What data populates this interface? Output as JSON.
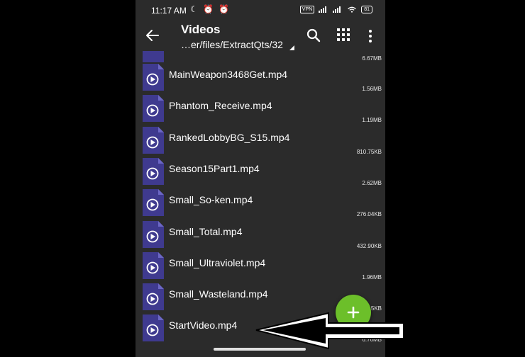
{
  "status_bar": {
    "time": "11:17 AM",
    "glyphs": "☾ ⏰ ⏰",
    "vpn": "VPN",
    "battery": "81"
  },
  "app_bar": {
    "title": "Videos",
    "path": "…er/files/ExtractQts/32"
  },
  "icons": {
    "back": "arrow-left-icon",
    "search": "search-icon",
    "grid": "grid-view-icon",
    "more": "more-vertical-icon",
    "file": "video-file-icon",
    "add": "plus-icon"
  },
  "colors": {
    "background": "#2b2b2b",
    "file_icon": "#3f3a8f",
    "fab": "#6cbf2a"
  },
  "files": {
    "partial_top_size": "6.67MB",
    "items": [
      {
        "name": "MainWeapon3468Get.mp4",
        "size": "1.56MB"
      },
      {
        "name": "Phantom_Receive.mp4",
        "size": "1.19MB"
      },
      {
        "name": "RankedLobbyBG_S15.mp4",
        "size": "810.75KB"
      },
      {
        "name": "Season15Part1.mp4",
        "size": "2.62MB"
      },
      {
        "name": "Small_So-ken.mp4",
        "size": "276.04KB"
      },
      {
        "name": "Small_Total.mp4",
        "size": "432.90KB"
      },
      {
        "name": "Small_Ultraviolet.mp4",
        "size": "1.96MB"
      },
      {
        "name": "Small_Wasteland.mp4",
        "size": "5KB"
      },
      {
        "name": "StartVideo.mp4",
        "size": "6.76MB"
      }
    ]
  }
}
